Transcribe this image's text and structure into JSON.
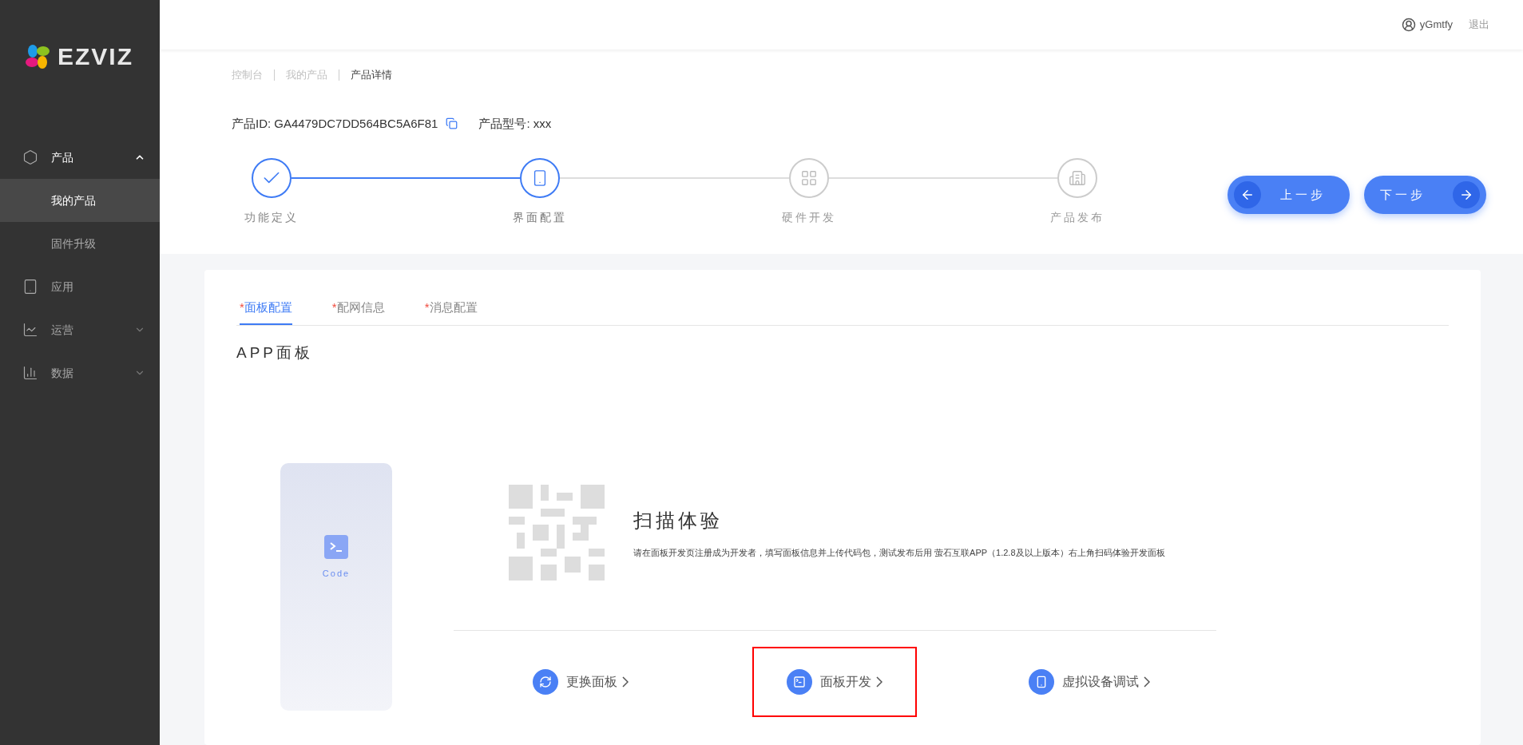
{
  "sidebar": {
    "logo": "EZVIZ",
    "items": [
      {
        "kind": "group",
        "label": "产品",
        "expanded": true,
        "selected": false,
        "children": [
          {
            "label": "我的产品",
            "selected": true
          },
          {
            "label": "固件升级",
            "selected": false
          }
        ]
      },
      {
        "kind": "link",
        "label": "应用",
        "selected": false
      },
      {
        "kind": "group",
        "label": "运营",
        "expanded": false,
        "selected": false
      },
      {
        "kind": "group",
        "label": "数据",
        "expanded": false,
        "selected": false
      }
    ]
  },
  "header": {
    "user": "yGmtfy",
    "logout": "退出"
  },
  "breadcrumb": [
    "控制台",
    "我的产品",
    "产品详情"
  ],
  "product": {
    "id_label": "产品ID: GA4479DC7DD564BC5A6F81",
    "model_label": "产品型号: xxx"
  },
  "steps": [
    {
      "label": "功能定义",
      "completed": true,
      "current": false
    },
    {
      "label": "界面配置",
      "completed": false,
      "current": true
    },
    {
      "label": "硬件开发",
      "completed": false,
      "current": false
    },
    {
      "label": "产品发布",
      "completed": false,
      "current": false
    }
  ],
  "nav_buttons": {
    "prev": "上一步",
    "next": "下一步"
  },
  "tabs": [
    {
      "required_mark": "*",
      "label": "面板配置",
      "selected": true
    },
    {
      "required_mark": "*",
      "label": "配网信息",
      "selected": false
    },
    {
      "required_mark": "*",
      "label": "消息配置",
      "selected": false
    }
  ],
  "section_title": "APP面板",
  "panel_preview": {
    "caption": "Code"
  },
  "scan": {
    "title": "扫描体验",
    "description": "请在面板开发页注册成为开发者，填写面板信息并上传代码包，测试发布后用 萤石互联APP（1.2.8及以上版本）右上角扫码体验开发面板"
  },
  "actions": [
    {
      "label": "更换面板",
      "highlighted": false
    },
    {
      "label": "面板开发",
      "highlighted": true
    },
    {
      "label": "虚拟设备调试",
      "highlighted": false
    }
  ]
}
